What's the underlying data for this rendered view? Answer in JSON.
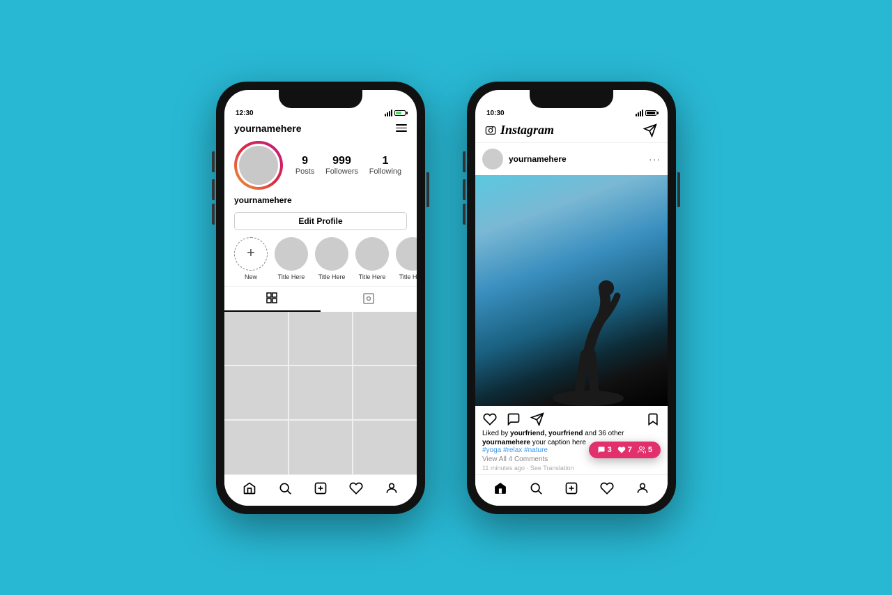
{
  "bg_color": "#29b8d4",
  "phone1": {
    "status_time": "12:30",
    "header": {
      "username": "yournamehere",
      "menu_label": "menu"
    },
    "stats": {
      "posts_count": "9",
      "posts_label": "Posts",
      "followers_count": "999",
      "followers_label": "Followers",
      "following_count": "1",
      "following_label": "Following"
    },
    "profile_name": "yournamehere",
    "edit_btn": "Edit Profile",
    "stories": [
      {
        "label": "New",
        "type": "new"
      },
      {
        "label": "Title Here",
        "type": "gray"
      },
      {
        "label": "Title Here",
        "type": "gray"
      },
      {
        "label": "Title Here",
        "type": "gray"
      },
      {
        "label": "Title Here",
        "type": "gray"
      }
    ],
    "nav": [
      "home",
      "search",
      "add",
      "heart",
      "profile"
    ]
  },
  "phone2": {
    "status_time": "10:30",
    "header": {
      "app_name": "Instagram"
    },
    "post": {
      "username": "yournamehere",
      "likes_text": "Liked by",
      "liked_by": "yourfriend, yourfriend",
      "and_others": "and 36 other",
      "caption_user": "yournamehere",
      "caption": "your caption here",
      "hashtags": "#yoga #relax #nature",
      "view_comments": "View All 4 Comments",
      "time": "11 minutes ago",
      "see_translation": "See Translation"
    },
    "notifications": {
      "comments": "3",
      "likes": "7",
      "followers": "5"
    },
    "nav": [
      "home",
      "search",
      "add",
      "heart",
      "profile"
    ]
  }
}
